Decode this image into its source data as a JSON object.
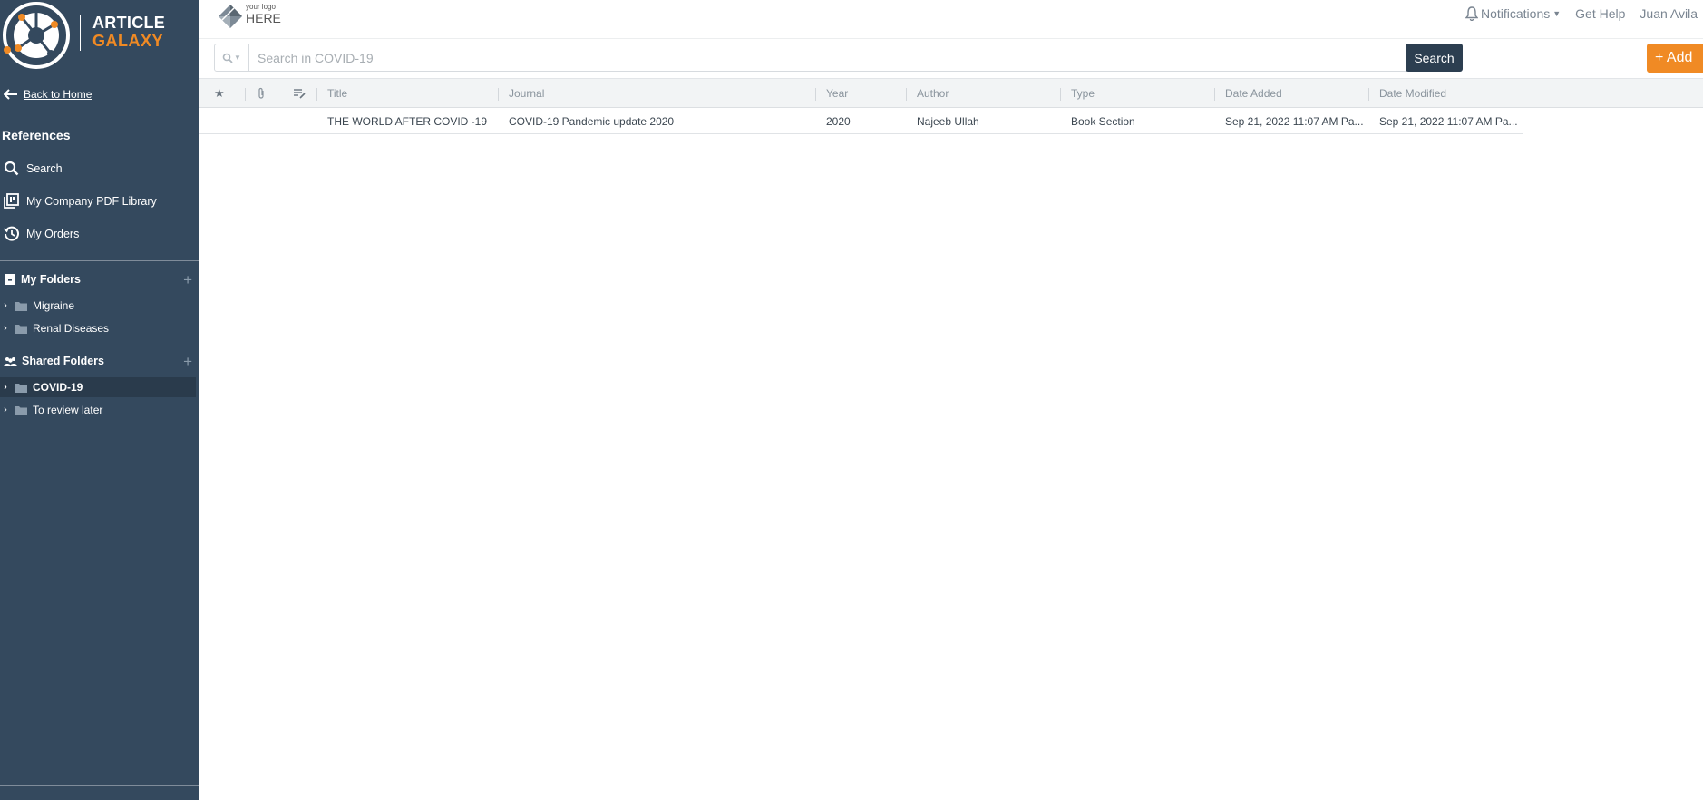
{
  "brand": {
    "line1": "ARTICLE",
    "line2": "GALAXY"
  },
  "sidebar": {
    "back_home": "Back to Home",
    "references_title": "References",
    "nav": [
      {
        "label": "Search",
        "icon": "search-icon"
      },
      {
        "label": "My Company PDF Library",
        "icon": "pdf-library-icon"
      },
      {
        "label": "My Orders",
        "icon": "history-icon"
      }
    ],
    "my_folders": {
      "title": "My Folders",
      "items": [
        "Migraine",
        "Renal Diseases"
      ]
    },
    "shared_folders": {
      "title": "Shared Folders",
      "items": [
        "COVID-19",
        "To review later"
      ],
      "active": "COVID-19"
    }
  },
  "header": {
    "logo_small": "your logo",
    "logo_big": "HERE",
    "notifications": "Notifications",
    "get_help": "Get Help",
    "user": "Juan Avila"
  },
  "search": {
    "placeholder": "Search in COVID-19",
    "button": "Search"
  },
  "add_button": "+ Add",
  "table": {
    "columns": [
      "Title",
      "Journal",
      "Year",
      "Author",
      "Type",
      "Date Added",
      "Date Modified"
    ],
    "rows": [
      {
        "title": "THE WORLD AFTER COVID -19",
        "journal": "COVID-19 Pandemic update 2020",
        "year": "2020",
        "author": "Najeeb Ullah",
        "type": "Book Section",
        "date_added": "Sep 21, 2022 11:07 AM Pa...",
        "date_modified": "Sep 21, 2022 11:07 AM Pa..."
      }
    ]
  },
  "colors": {
    "sidebar_bg": "#34495e",
    "accent_orange": "#f08a24",
    "search_button": "#2c3e50"
  }
}
